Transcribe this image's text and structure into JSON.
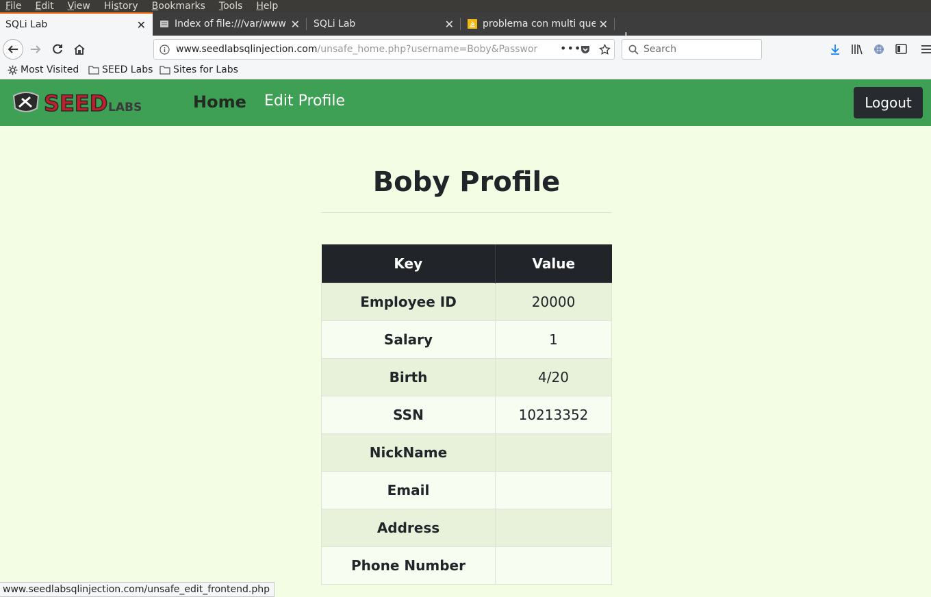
{
  "menubar": {
    "items": [
      {
        "accel": "F",
        "rest": "ile"
      },
      {
        "accel": "E",
        "rest": "dit"
      },
      {
        "accel": "V",
        "rest": "iew"
      },
      {
        "pre": "Hi",
        "accel": "s",
        "rest": "tory"
      },
      {
        "accel": "B",
        "rest": "ookmarks"
      },
      {
        "accel": "T",
        "rest": "ools"
      },
      {
        "accel": "H",
        "rest": "elp"
      }
    ]
  },
  "tabs": [
    {
      "title": "SQLi Lab",
      "active": true
    },
    {
      "title": "Index of file:///var/www",
      "icon": "file-icon"
    },
    {
      "title": "SQLi Lab"
    },
    {
      "title": "problema con multi que",
      "icon": "stackoverflow-icon"
    }
  ],
  "urlbar": {
    "host": "www.seedlabsqlinjection.com",
    "path": "/unsafe_home.php?username=Boby&Password"
  },
  "search": {
    "placeholder": "Search"
  },
  "bookmarks": [
    "Most Visited",
    "SEED Labs",
    "Sites for Labs"
  ],
  "site": {
    "logo_text": "SEED LABS",
    "nav": {
      "home": "Home",
      "edit_profile": "Edit Profile",
      "logout": "Logout"
    },
    "title": "Boby Profile",
    "table": {
      "headers": [
        "Key",
        "Value"
      ],
      "rows": [
        {
          "key": "Employee ID",
          "value": "20000"
        },
        {
          "key": "Salary",
          "value": "1"
        },
        {
          "key": "Birth",
          "value": "4/20"
        },
        {
          "key": "SSN",
          "value": "10213352"
        },
        {
          "key": "NickName",
          "value": ""
        },
        {
          "key": "Email",
          "value": ""
        },
        {
          "key": "Address",
          "value": ""
        },
        {
          "key": "Phone Number",
          "value": ""
        }
      ]
    }
  },
  "status": "www.seedlabsqlinjection.com/unsafe_edit_frontend.php",
  "colors": {
    "nav_green": "#3ea055",
    "page_bg": "#f2fde4",
    "table_header": "#212529",
    "accent_tab": "#ff6a0a"
  }
}
